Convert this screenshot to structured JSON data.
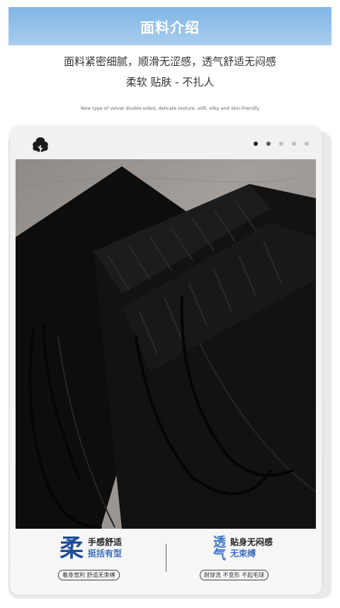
{
  "header": {
    "title": "面料介绍"
  },
  "description": {
    "line1": "面料紧密细腻，顺滑无涩感，透气舒适无闷感",
    "line2": "柔软 贴肤 - 不扎人",
    "english": "New type of velvet double-sided, delicate texture, soft, silky and skin-friendly"
  },
  "carousel": {
    "dot_count": 5,
    "active_index": 0
  },
  "icons": {
    "brand": "tree-cloud-icon"
  },
  "features": [
    {
      "big": "柔",
      "line1": "手感舒适",
      "line2": "挺括有型",
      "pill": "着身宽利  舒适无束缚"
    },
    {
      "big_top": "透",
      "big_bottom": "气",
      "line1": "贴身无闷感",
      "line2": "无束缚",
      "pill": "耐穿洗  不变形  不起毛球"
    }
  ],
  "colors": {
    "accent": "#1f4e99",
    "header_bg": "#8fc0ea"
  }
}
